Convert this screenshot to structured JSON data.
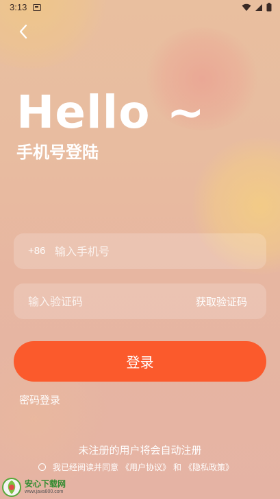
{
  "status_bar": {
    "time": "3:13",
    "notification_icon": "notification-icon",
    "wifi_icon": "wifi-icon",
    "signal_icon": "signal-icon",
    "battery_icon": "battery-icon"
  },
  "header": {
    "back_icon": "back-arrow-icon"
  },
  "hero": {
    "greeting": "Hello ~",
    "subtitle": "手机号登陆"
  },
  "phone_field": {
    "prefix": "+86",
    "placeholder": "输入手机号",
    "value": ""
  },
  "code_field": {
    "placeholder": "输入验证码",
    "value": "",
    "get_code_label": "获取验证码"
  },
  "login_button": {
    "label": "登录",
    "color": "#fb5a2c"
  },
  "password_login_label": "密码登录",
  "footer": {
    "auto_register_notice": "未注册的用户将会自动注册",
    "agreement_prefix": "我已经阅读并同意",
    "user_agreement": "《用户协议》",
    "conjunction": "和",
    "privacy_policy": "《隐私政策》",
    "agreement_checked": false
  },
  "watermark": {
    "title": "安心下载网",
    "url": "www.java800.com",
    "logo_text": "绿色 安全"
  },
  "colors": {
    "background": "#e8bca0",
    "text": "#ffffff",
    "accent": "#fb5a2c"
  }
}
